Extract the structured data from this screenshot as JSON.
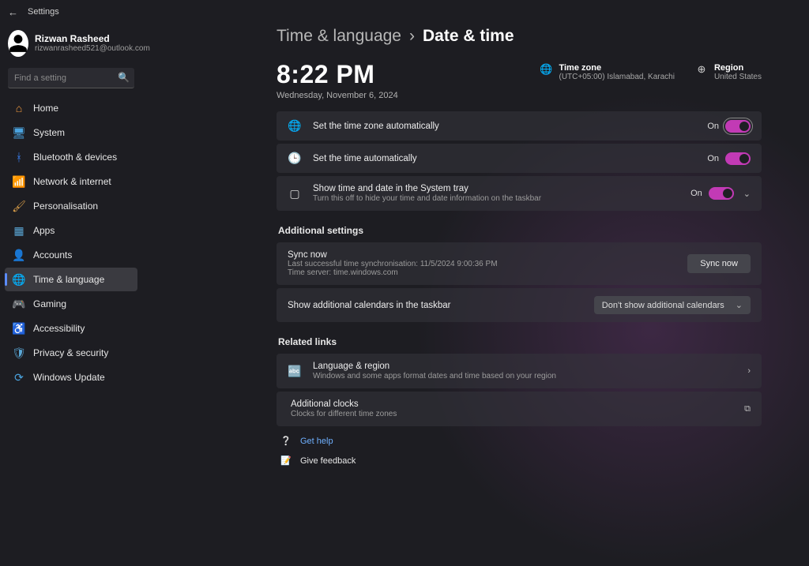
{
  "titlebar": {
    "label": "Settings"
  },
  "user": {
    "name": "Rizwan Rasheed",
    "email": "rizwanrasheed521@outlook.com"
  },
  "search": {
    "placeholder": "Find a setting"
  },
  "nav": [
    {
      "label": "Home"
    },
    {
      "label": "System"
    },
    {
      "label": "Bluetooth & devices"
    },
    {
      "label": "Network & internet"
    },
    {
      "label": "Personalisation"
    },
    {
      "label": "Apps"
    },
    {
      "label": "Accounts"
    },
    {
      "label": "Time & language"
    },
    {
      "label": "Gaming"
    },
    {
      "label": "Accessibility"
    },
    {
      "label": "Privacy & security"
    },
    {
      "label": "Windows Update"
    }
  ],
  "breadcrumb": {
    "parent": "Time & language",
    "current": "Date & time"
  },
  "clock": {
    "time": "8:22 PM",
    "date": "Wednesday, November 6, 2024"
  },
  "hero": {
    "timezone": {
      "label": "Time zone",
      "value": "(UTC+05:00) Islamabad, Karachi"
    },
    "region": {
      "label": "Region",
      "value": "United States"
    }
  },
  "rows": {
    "auto_tz": {
      "title": "Set the time zone automatically",
      "state": "On"
    },
    "auto_time": {
      "title": "Set the time automatically",
      "state": "On"
    },
    "systray": {
      "title": "Show time and date in the System tray",
      "sub": "Turn this off to hide your time and date information on the taskbar",
      "state": "On"
    }
  },
  "sections": {
    "additional": "Additional settings",
    "related": "Related links"
  },
  "sync": {
    "title": "Sync now",
    "sub1": "Last successful time synchronisation: 11/5/2024 9:00:36 PM",
    "sub2": "Time server: time.windows.com",
    "button": "Sync now"
  },
  "calendars": {
    "title": "Show additional calendars in the taskbar",
    "value": "Don't show additional calendars"
  },
  "related": {
    "lang": {
      "title": "Language & region",
      "sub": "Windows and some apps format dates and time based on your region"
    },
    "clocks": {
      "title": "Additional clocks",
      "sub": "Clocks for different time zones"
    }
  },
  "footer": {
    "help": "Get help",
    "feedback": "Give feedback"
  }
}
